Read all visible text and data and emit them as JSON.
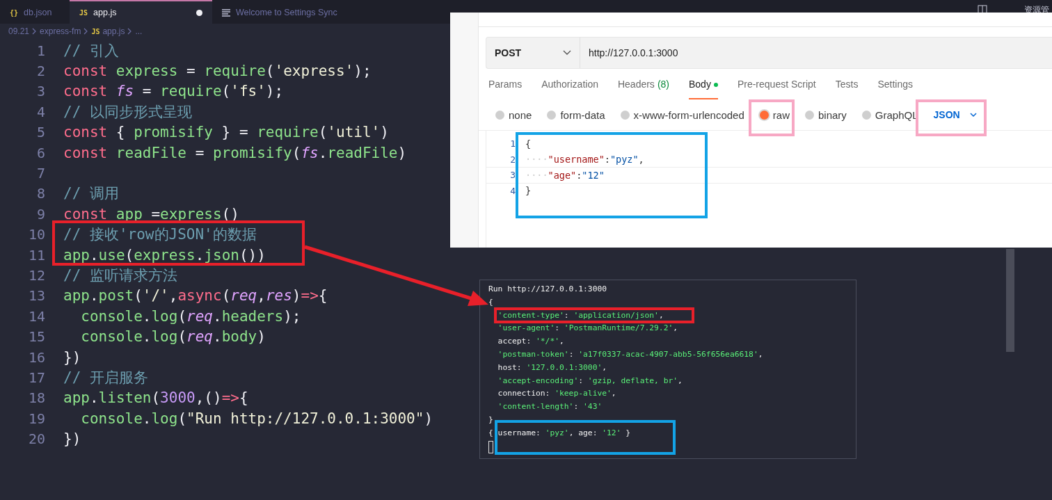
{
  "editor": {
    "tabs": [
      {
        "label": "db.json",
        "icon": "{}",
        "selected": false,
        "modified": false
      },
      {
        "label": "app.js",
        "icon": "JS",
        "selected": true,
        "modified": true
      },
      {
        "label": "Welcome to Settings Sync",
        "selected": false,
        "modified": false
      }
    ],
    "breadcrumb": [
      "09.21",
      "express-fm",
      "app.js",
      "..."
    ],
    "breadcrumb_file_icon": "JS",
    "panel_label": "资源管",
    "lines": [
      {
        "number": "1",
        "tokens": [
          {
            "kind": "comment",
            "text": "// 引入"
          }
        ]
      },
      {
        "number": "2",
        "tokens": [
          {
            "kind": "keyword",
            "text": "const"
          },
          {
            "kind": "var",
            "text": " express"
          },
          {
            "kind": "punct",
            "text": " = "
          },
          {
            "kind": "func",
            "text": "require"
          },
          {
            "kind": "punct",
            "text": "("
          },
          {
            "kind": "string",
            "text": "'express'"
          },
          {
            "kind": "punct",
            "text": ");"
          }
        ]
      },
      {
        "number": "3",
        "tokens": [
          {
            "kind": "keyword",
            "text": "const"
          },
          {
            "kind": "param",
            "text": " fs"
          },
          {
            "kind": "punct",
            "text": " = "
          },
          {
            "kind": "func",
            "text": "require"
          },
          {
            "kind": "punct",
            "text": "("
          },
          {
            "kind": "string",
            "text": "'fs'"
          },
          {
            "kind": "punct",
            "text": ");"
          }
        ]
      },
      {
        "number": "4",
        "tokens": [
          {
            "kind": "comment",
            "text": "// 以同步形式呈现"
          }
        ]
      },
      {
        "number": "5",
        "tokens": [
          {
            "kind": "keyword",
            "text": "const"
          },
          {
            "kind": "punct",
            "text": " { "
          },
          {
            "kind": "var",
            "text": "promisify"
          },
          {
            "kind": "punct",
            "text": " } = "
          },
          {
            "kind": "func",
            "text": "require"
          },
          {
            "kind": "punct",
            "text": "("
          },
          {
            "kind": "string",
            "text": "'util'"
          },
          {
            "kind": "punct",
            "text": ")"
          }
        ]
      },
      {
        "number": "6",
        "tokens": [
          {
            "kind": "keyword",
            "text": "const"
          },
          {
            "kind": "var",
            "text": " readFile"
          },
          {
            "kind": "punct",
            "text": " = "
          },
          {
            "kind": "func",
            "text": "promisify"
          },
          {
            "kind": "punct",
            "text": "("
          },
          {
            "kind": "param",
            "text": "fs"
          },
          {
            "kind": "punct",
            "text": "."
          },
          {
            "kind": "var",
            "text": "readFile"
          },
          {
            "kind": "punct",
            "text": ")"
          }
        ]
      },
      {
        "number": "7"
      },
      {
        "number": "8",
        "tokens": [
          {
            "kind": "comment",
            "text": "// 调用"
          }
        ]
      },
      {
        "number": "9",
        "tokens": [
          {
            "kind": "keyword",
            "text": "const"
          },
          {
            "kind": "var",
            "text": " app"
          },
          {
            "kind": "punct",
            "text": " ="
          },
          {
            "kind": "func",
            "text": "express"
          },
          {
            "kind": "punct",
            "text": "()"
          }
        ]
      },
      {
        "number": "10",
        "tokens": [
          {
            "kind": "comment",
            "text": "// 接收'row的JSON'的数据"
          }
        ]
      },
      {
        "number": "11",
        "tokens": [
          {
            "kind": "var",
            "text": "app"
          },
          {
            "kind": "punct",
            "text": "."
          },
          {
            "kind": "func",
            "text": "use"
          },
          {
            "kind": "punct",
            "text": "("
          },
          {
            "kind": "var",
            "text": "express"
          },
          {
            "kind": "punct",
            "text": "."
          },
          {
            "kind": "func",
            "text": "json"
          },
          {
            "kind": "punct",
            "text": "())"
          }
        ]
      },
      {
        "number": "12",
        "tokens": [
          {
            "kind": "comment",
            "text": "// 监听请求方法"
          }
        ]
      },
      {
        "number": "13",
        "tokens": [
          {
            "kind": "var",
            "text": "app"
          },
          {
            "kind": "punct",
            "text": "."
          },
          {
            "kind": "func",
            "text": "post"
          },
          {
            "kind": "punct",
            "text": "("
          },
          {
            "kind": "string",
            "text": "'/'"
          },
          {
            "kind": "punct",
            "text": ","
          },
          {
            "kind": "keyword",
            "text": "async"
          },
          {
            "kind": "punct",
            "text": "("
          },
          {
            "kind": "param",
            "text": "req"
          },
          {
            "kind": "punct",
            "text": ","
          },
          {
            "kind": "param",
            "text": "res"
          },
          {
            "kind": "punct",
            "text": ")"
          },
          {
            "kind": "keyword",
            "text": "=>"
          },
          {
            "kind": "punct",
            "text": "{"
          }
        ]
      },
      {
        "number": "14",
        "tokens": [
          {
            "kind": "var",
            "text": "  console"
          },
          {
            "kind": "punct",
            "text": "."
          },
          {
            "kind": "func",
            "text": "log"
          },
          {
            "kind": "punct",
            "text": "("
          },
          {
            "kind": "param",
            "text": "req"
          },
          {
            "kind": "punct",
            "text": "."
          },
          {
            "kind": "var",
            "text": "headers"
          },
          {
            "kind": "punct",
            "text": ");"
          }
        ]
      },
      {
        "number": "15",
        "tokens": [
          {
            "kind": "var",
            "text": "  console"
          },
          {
            "kind": "punct",
            "text": "."
          },
          {
            "kind": "func",
            "text": "log"
          },
          {
            "kind": "punct",
            "text": "("
          },
          {
            "kind": "param",
            "text": "req"
          },
          {
            "kind": "punct",
            "text": "."
          },
          {
            "kind": "var",
            "text": "body"
          },
          {
            "kind": "punct",
            "text": ")"
          }
        ]
      },
      {
        "number": "16",
        "tokens": [
          {
            "kind": "punct",
            "text": "})"
          }
        ]
      },
      {
        "number": "17",
        "tokens": [
          {
            "kind": "comment",
            "text": "// 开启服务"
          }
        ]
      },
      {
        "number": "18",
        "tokens": [
          {
            "kind": "var",
            "text": "app"
          },
          {
            "kind": "punct",
            "text": "."
          },
          {
            "kind": "func",
            "text": "listen"
          },
          {
            "kind": "punct",
            "text": "("
          },
          {
            "kind": "number",
            "text": "3000"
          },
          {
            "kind": "punct",
            "text": ",()"
          },
          {
            "kind": "keyword",
            "text": "=>"
          },
          {
            "kind": "punct",
            "text": "{"
          }
        ]
      },
      {
        "number": "19",
        "tokens": [
          {
            "kind": "var",
            "text": "  console"
          },
          {
            "kind": "punct",
            "text": "."
          },
          {
            "kind": "func",
            "text": "log"
          },
          {
            "kind": "punct",
            "text": "("
          },
          {
            "kind": "string",
            "text": "\"Run http://127.0.0.1:3000\""
          },
          {
            "kind": "punct",
            "text": ")"
          }
        ]
      },
      {
        "number": "20",
        "tokens": [
          {
            "kind": "punct",
            "text": "})"
          }
        ]
      }
    ]
  },
  "postman": {
    "method": "POST",
    "url": "http://127.0.0.1:3000",
    "tabs": [
      {
        "label": "Params",
        "selected": false
      },
      {
        "label": "Authorization",
        "selected": false
      },
      {
        "label": "Headers",
        "count": "(8)",
        "selected": false
      },
      {
        "label": "Body",
        "selected": true,
        "indicator": true
      },
      {
        "label": "Pre-request Script",
        "selected": false
      },
      {
        "label": "Tests",
        "selected": false
      },
      {
        "label": "Settings",
        "selected": false
      }
    ],
    "body_modes": [
      {
        "label": "none",
        "selected": false
      },
      {
        "label": "form-data",
        "selected": false
      },
      {
        "label": "x-www-form-urlencoded",
        "selected": false
      },
      {
        "label": "raw",
        "selected": true
      },
      {
        "label": "binary",
        "selected": false
      },
      {
        "label": "GraphQL",
        "selected": false
      }
    ],
    "format": "JSON",
    "body_lines": [
      {
        "number": "1",
        "tokens": [
          {
            "kind": "punct",
            "text": "{"
          }
        ]
      },
      {
        "number": "2",
        "tokens": [
          {
            "kind": "space",
            "text": "····"
          },
          {
            "kind": "key",
            "text": "\"username\""
          },
          {
            "kind": "punct",
            "text": ":"
          },
          {
            "kind": "string",
            "text": "\"pyz\""
          },
          {
            "kind": "punct",
            "text": ","
          }
        ]
      },
      {
        "number": "3",
        "tokens": [
          {
            "kind": "space",
            "text": "····"
          },
          {
            "kind": "key",
            "text": "\"age\""
          },
          {
            "kind": "punct",
            "text": ":"
          },
          {
            "kind": "string",
            "text": "\"12\""
          }
        ]
      },
      {
        "number": "4",
        "tokens": [
          {
            "kind": "punct",
            "text": "}"
          }
        ]
      }
    ]
  },
  "terminal": {
    "lines": [
      {
        "tokens": [
          {
            "kind": "text",
            "text": "Run http://127.0.0.1:3000"
          }
        ]
      },
      {
        "tokens": [
          {
            "kind": "text",
            "text": "{"
          }
        ]
      },
      {
        "tokens": [
          {
            "kind": "string",
            "text": "  'content-type'"
          },
          {
            "kind": "text",
            "text": ": "
          },
          {
            "kind": "string",
            "text": "'application/json'"
          },
          {
            "kind": "text",
            "text": ","
          }
        ]
      },
      {
        "tokens": [
          {
            "kind": "string",
            "text": "  'user-agent'"
          },
          {
            "kind": "text",
            "text": ": "
          },
          {
            "kind": "string",
            "text": "'PostmanRuntime/7.29.2'"
          },
          {
            "kind": "text",
            "text": ","
          }
        ]
      },
      {
        "tokens": [
          {
            "kind": "text",
            "text": "  accept: "
          },
          {
            "kind": "string",
            "text": "'*/*'"
          },
          {
            "kind": "text",
            "text": ","
          }
        ]
      },
      {
        "tokens": [
          {
            "kind": "string",
            "text": "  'postman-token'"
          },
          {
            "kind": "text",
            "text": ": "
          },
          {
            "kind": "string",
            "text": "'a17f0337-acac-4907-abb5-56f656ea6618'"
          },
          {
            "kind": "text",
            "text": ","
          }
        ]
      },
      {
        "tokens": [
          {
            "kind": "text",
            "text": "  host: "
          },
          {
            "kind": "string",
            "text": "'127.0.0.1:3000'"
          },
          {
            "kind": "text",
            "text": ","
          }
        ]
      },
      {
        "tokens": [
          {
            "kind": "string",
            "text": "  'accept-encoding'"
          },
          {
            "kind": "text",
            "text": ": "
          },
          {
            "kind": "string",
            "text": "'gzip, deflate, br'"
          },
          {
            "kind": "text",
            "text": ","
          }
        ]
      },
      {
        "tokens": [
          {
            "kind": "text",
            "text": "  connection: "
          },
          {
            "kind": "string",
            "text": "'keep-alive'"
          },
          {
            "kind": "text",
            "text": ","
          }
        ]
      },
      {
        "tokens": [
          {
            "kind": "string",
            "text": "  'content-length'"
          },
          {
            "kind": "text",
            "text": ": "
          },
          {
            "kind": "string",
            "text": "'43'"
          }
        ]
      },
      {
        "tokens": [
          {
            "kind": "text",
            "text": "}"
          }
        ]
      },
      {
        "tokens": [
          {
            "kind": "text",
            "text": "{ username: "
          },
          {
            "kind": "string",
            "text": "'pyz'"
          },
          {
            "kind": "text",
            "text": ", age: "
          },
          {
            "kind": "string",
            "text": "'12'"
          },
          {
            "kind": "text",
            "text": " }"
          }
        ]
      }
    ]
  },
  "annotations": [
    {
      "kind": "box",
      "color": "#e8202a"
    },
    {
      "kind": "arrow",
      "color": "#e8202a"
    },
    {
      "kind": "box",
      "color": "#e8202a"
    },
    {
      "kind": "box",
      "color": "#13a3e6"
    },
    {
      "kind": "box",
      "color": "#f7a8c4"
    },
    {
      "kind": "box",
      "color": "#f7a8c4"
    },
    {
      "kind": "box",
      "color": "#13a3e6"
    }
  ]
}
